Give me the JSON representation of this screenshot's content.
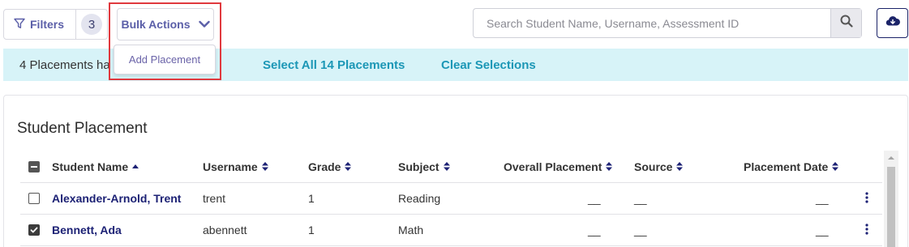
{
  "toolbar": {
    "filters_label": "Filters",
    "filters_count": "3",
    "bulk_actions_label": "Bulk Actions",
    "bulk_menu_items": [
      "Add Placement"
    ],
    "search_placeholder": "Search Student Name, Username, Assessment ID"
  },
  "selection": {
    "status_text": "4 Placements ha",
    "select_all_label": "Select All 14 Placements",
    "clear_label": "Clear Selections"
  },
  "card": {
    "title": "Student Placement"
  },
  "table": {
    "columns": {
      "student_name": "Student Name",
      "username": "Username",
      "grade": "Grade",
      "subject": "Subject",
      "overall_placement": "Overall Placement",
      "source": "Source",
      "placement_date": "Placement Date"
    },
    "rows": [
      {
        "checked": false,
        "student_name": "Alexander-Arnold, Trent",
        "username": "trent",
        "grade": "1",
        "subject": "Reading",
        "overall_placement": "__",
        "source": "__",
        "placement_date": "__"
      },
      {
        "checked": true,
        "student_name": "Bennett, Ada",
        "username": "abennett",
        "grade": "1",
        "subject": "Math",
        "overall_placement": "__",
        "source": "__",
        "placement_date": "__"
      }
    ]
  },
  "colors": {
    "accent": "#5b5fa8",
    "link": "#1d2275",
    "selection_bar": "#d7f3f8",
    "selection_link": "#1c97b6",
    "highlight": "#e0393e"
  },
  "icons": [
    "filter-icon",
    "chevron-down-icon",
    "search-icon",
    "cloud-download-icon",
    "sort-asc-icon",
    "sort-both-icon",
    "kebab-icon",
    "checkmark-icon",
    "scroll-up-icon"
  ]
}
